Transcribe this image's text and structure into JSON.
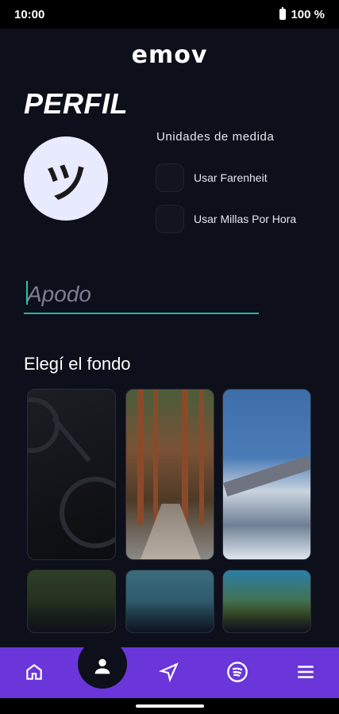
{
  "status_bar": {
    "time": "10:00",
    "battery": "100 %"
  },
  "app": {
    "logo": "emov"
  },
  "page": {
    "title": "PERFIL"
  },
  "avatar": {
    "glyph": "ツ"
  },
  "units": {
    "title": "Unidades de medida",
    "options": [
      {
        "label": "Usar Farenheit",
        "checked": false
      },
      {
        "label": "Usar Millas Por Hora",
        "checked": false
      }
    ]
  },
  "nickname": {
    "placeholder": "Apodo",
    "value": ""
  },
  "background": {
    "title": "Elegí el fondo",
    "options": [
      "bike",
      "forest-path",
      "mountain-road",
      "forest-lake",
      "ocean",
      "tropical"
    ]
  },
  "nav": {
    "items": [
      {
        "name": "home-icon"
      },
      {
        "name": "profile-icon",
        "active": true
      },
      {
        "name": "navigation-icon"
      },
      {
        "name": "spotify-icon"
      },
      {
        "name": "menu-icon"
      }
    ]
  },
  "colors": {
    "accent": "#2ec4a6",
    "nav": "#6a36d9",
    "bg": "#0d0f1a"
  }
}
